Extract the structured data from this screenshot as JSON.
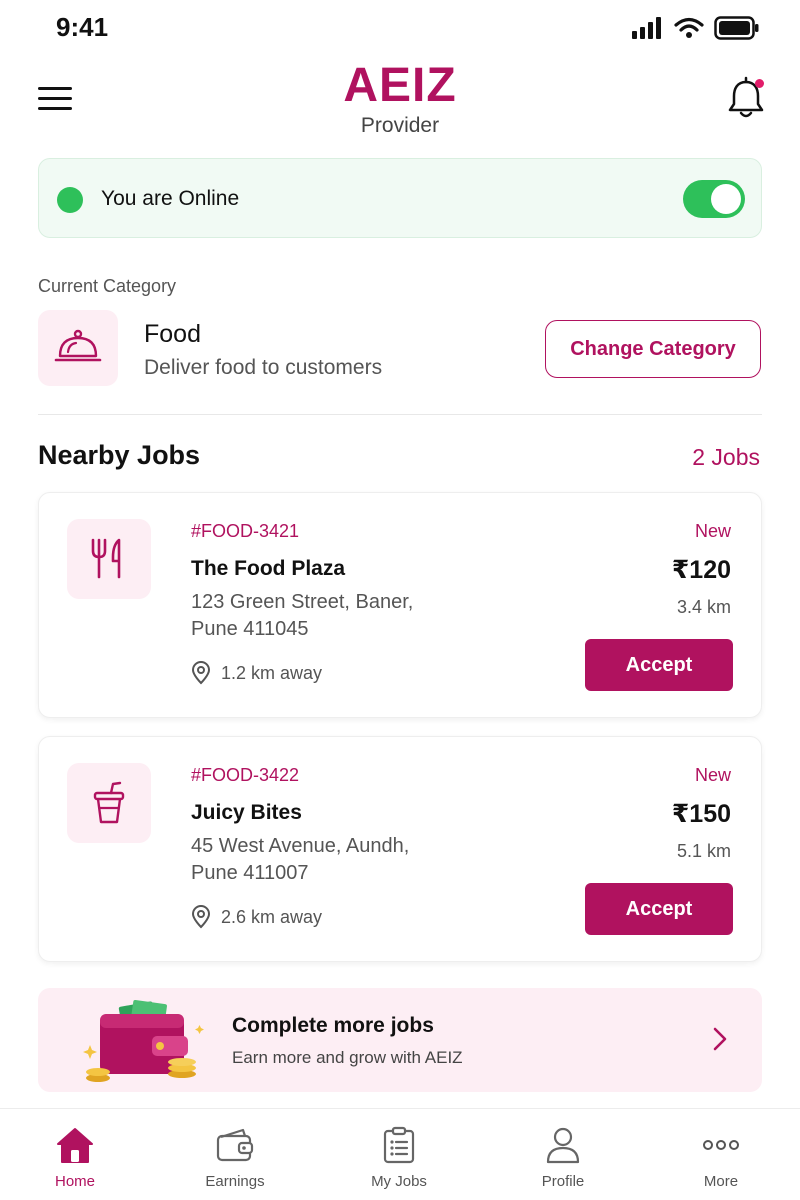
{
  "status_bar": {
    "time": "9:41"
  },
  "header": {
    "logo": "AEIZ",
    "subtitle": "Provider"
  },
  "online": {
    "label": "You are Online",
    "toggle_on": true
  },
  "category": {
    "section_title": "Current Category",
    "name": "Food",
    "description": "Deliver food to customers",
    "change_button": "Change Category"
  },
  "nearby": {
    "title": "Nearby Jobs",
    "count": "2 Jobs",
    "jobs": [
      {
        "id": "#FOOD-3421",
        "name": "The Food Plaza",
        "address_line1": "123 Green Street, Baner,",
        "address_line2": "Pune 411045",
        "distance": "1.2 km away",
        "status": "New",
        "price": "₹120",
        "km": "3.4 km",
        "accept": "Accept",
        "icon": "cutlery-icon"
      },
      {
        "id": "#FOOD-3422",
        "name": "Juicy Bites",
        "address_line1": "45 West Avenue, Aundh,",
        "address_line2": "Pune 411007",
        "distance": "2.6 km away",
        "status": "New",
        "price": "₹150",
        "km": "5.1 km",
        "accept": "Accept",
        "icon": "drink-cup-icon"
      }
    ]
  },
  "promo": {
    "title": "Complete more jobs",
    "subtitle": "Earn more and grow with AEIZ"
  },
  "tabs": [
    {
      "label": "Home",
      "icon": "home-icon",
      "active": true
    },
    {
      "label": "Earnings",
      "icon": "wallet-icon",
      "active": false
    },
    {
      "label": "My Jobs",
      "icon": "clipboard-icon",
      "active": false
    },
    {
      "label": "Profile",
      "icon": "profile-icon",
      "active": false
    },
    {
      "label": "More",
      "icon": "more-icon",
      "active": false
    }
  ],
  "colors": {
    "brand": "#b0125f",
    "online": "#2ec05a",
    "tint": "#fdeef4"
  }
}
